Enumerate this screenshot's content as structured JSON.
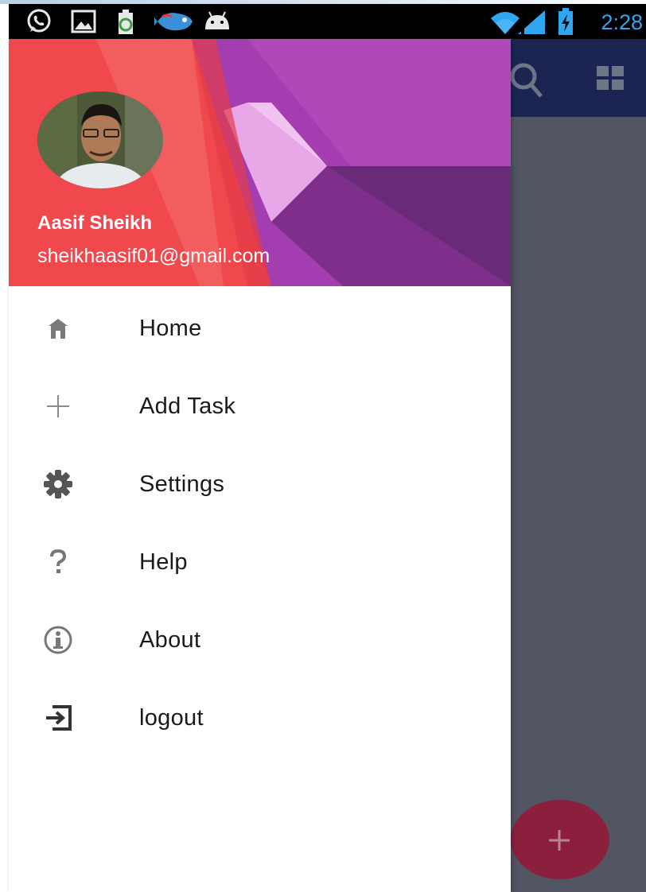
{
  "status_bar": {
    "time": "2:28",
    "left_icons": [
      "whatsapp-icon",
      "gallery-icon",
      "battery-saver-icon",
      "fish-app-icon",
      "android-icon"
    ],
    "right_icons": [
      "wifi-icon",
      "signal-icon",
      "battery-charging-icon"
    ],
    "time_color": "#2ea6f0"
  },
  "drawer": {
    "user": {
      "name": "Aasif Sheikh",
      "email": "sheikhaasif01@gmail.com"
    },
    "items": [
      {
        "label": "Home",
        "icon": "home-icon"
      },
      {
        "label": "Add Task",
        "icon": "plus-icon"
      },
      {
        "label": "Settings",
        "icon": "gear-icon"
      },
      {
        "label": "Help",
        "icon": "question-icon"
      },
      {
        "label": "About",
        "icon": "info-icon"
      },
      {
        "label": "logout",
        "icon": "exit-icon"
      }
    ]
  },
  "background_app": {
    "toolbar_icons": [
      "search-icon",
      "grid-view-icon"
    ],
    "fab_icon": "plus-icon",
    "colors": {
      "toolbar": "#1c2552",
      "content": "#525562",
      "fab": "#8c1f3e"
    }
  }
}
